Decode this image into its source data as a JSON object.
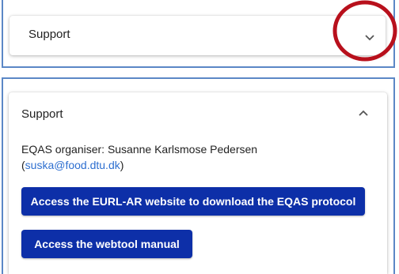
{
  "top_panel": {
    "title": "Support",
    "toggle_icon": "chevron-down-icon",
    "highlight_color": "#b8101c"
  },
  "bottom_panel": {
    "title": "Support",
    "toggle_icon": "chevron-up-icon",
    "organiser_label": "EQAS organiser: Susanne Karlsmose Pedersen",
    "paren_open": "(",
    "email": "suska@food.dtu.dk",
    "paren_close": ")",
    "buttons": [
      {
        "label": "Access the EURL-AR website to download the EQAS protocol"
      },
      {
        "label": "Access the webtool manual"
      }
    ]
  },
  "colors": {
    "frame": "#5b87c6",
    "button_bg": "#0d2fa8",
    "link": "#2e6fd0"
  }
}
